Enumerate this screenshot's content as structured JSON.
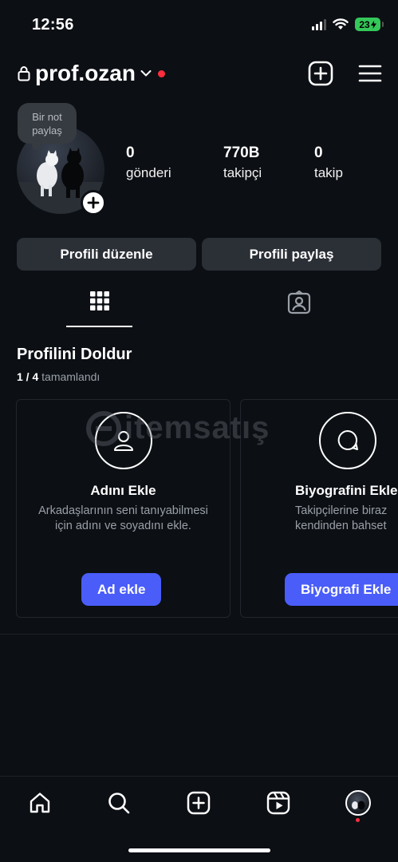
{
  "status_bar": {
    "time": "12:56",
    "battery": "23"
  },
  "header": {
    "username": "prof.ozan",
    "icons": [
      "lock-icon",
      "chevron-down-icon",
      "plus-square-icon",
      "menu-icon"
    ]
  },
  "profile": {
    "note_bubble": "Bir not\npaylaş",
    "stats": [
      {
        "value": "0",
        "label": "gönderi"
      },
      {
        "value": "770B",
        "label": "takipçi"
      },
      {
        "value": "0",
        "label": "takip"
      }
    ],
    "buttons": {
      "edit": "Profili düzenle",
      "share": "Profili paylaş"
    }
  },
  "tabs": [
    "grid-icon",
    "tagged-icon"
  ],
  "complete_profile": {
    "title": "Profilini Doldur",
    "progress_count": "1 / 4",
    "progress_label": "tamamlandı",
    "cards": [
      {
        "icon": "person-icon",
        "title": "Adını Ekle",
        "description": "Arkadaşlarının seni tanıyabilmesi\niçin adını ve soyadını ekle.",
        "button": "Ad ekle"
      },
      {
        "icon": "chat-bubble-icon",
        "title": "Biyografini Ekle",
        "description": "Takipçilerine biraz\nkendinden bahset",
        "button": "Biyografi Ekle"
      }
    ]
  },
  "watermark": "itemsatış",
  "bottom_nav": [
    "home-icon",
    "search-icon",
    "create-icon",
    "reels-icon",
    "profile-avatar"
  ],
  "colors": {
    "background": "#0c0f14",
    "button": "#2b2f36",
    "primary": "#4a5df9",
    "notification": "#ff2d3d",
    "battery": "#34c759"
  }
}
